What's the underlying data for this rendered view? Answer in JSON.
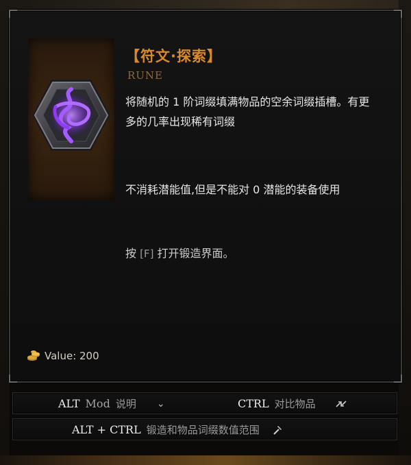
{
  "tooltip": {
    "title": "【符文·探索】",
    "subtitle": "RUNE",
    "description_1": "将随机的 1 阶词缀填满物品的空余词缀插槽。有更多的几率出现稀有词缀",
    "description_2": "不消耗潜能值,但是不能对 0 潜能的装备使用",
    "hint_prefix": "按",
    "hint_key": "[F]",
    "hint_suffix": "打开锻造界面。",
    "value_label": "Value: 200"
  },
  "footer": {
    "alt_key": "ALT",
    "alt_mod": "Mod",
    "alt_text": "说明",
    "ctrl_key": "CTRL",
    "ctrl_text": "对比物品",
    "altctrl_key": "ALT + CTRL",
    "altctrl_text": "锻造和物品词缀数值范围"
  },
  "icons": {
    "rune": "rune-icon",
    "coin": "coin-stack-icon",
    "chevron": "chevron-down-icon",
    "compare": "compare-icon",
    "hammer": "hammer-icon"
  },
  "colors": {
    "title": "#d98a2b",
    "subtitle": "#8a6a44",
    "rune_glow": "#9b4dff"
  }
}
